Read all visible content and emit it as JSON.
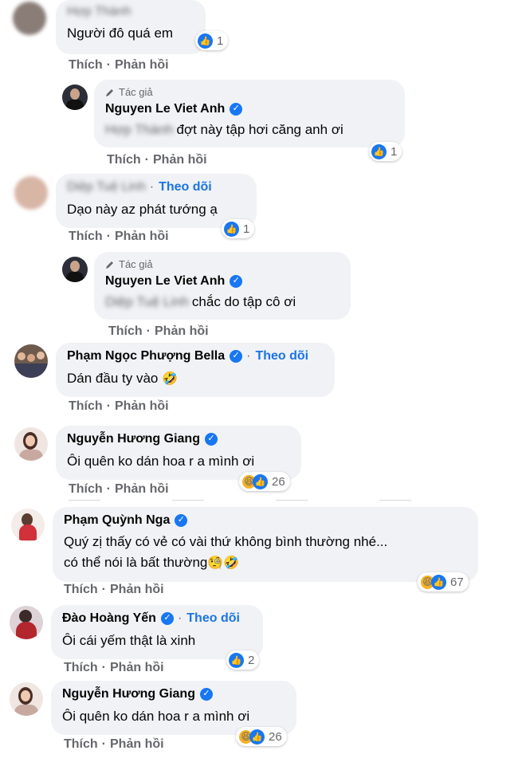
{
  "actions": {
    "like": "Thích",
    "reply": "Phản hồi"
  },
  "labels": {
    "author": "Tác giả",
    "follow": "Theo dõi",
    "dot": "·"
  },
  "comments": [
    {
      "name": "Hợp Thành",
      "text": "Người đô quá em",
      "reactions": "1"
    },
    {
      "name": "Nguyen Le Viet Anh",
      "mention": "Hợp Thành",
      "text": "đợt này tập hơi căng anh ơi",
      "reactions": "1"
    },
    {
      "name": "Diệp Tuệ Linh",
      "text": "Dạo này az phát tướng ạ",
      "reactions": "1"
    },
    {
      "name": "Nguyen Le Viet Anh",
      "mention": "Diệp Tuệ Linh",
      "text": "chắc do tập cô ơi"
    },
    {
      "name": "Phạm Ngọc Phượng Bella",
      "text": "Dán đầu ty vào",
      "emoji": "🤣"
    },
    {
      "name": "Nguyễn Hương Giang",
      "text": "Ôi quên ko dán hoa r a mình ơi",
      "reactions": "26"
    },
    {
      "name": "Phạm Quỳnh Nga",
      "text": "Quý zị thấy có vẻ có vài thứ không bình thường nhé...",
      "text2": "có thể nói là bất thường",
      "emoji": "🧐🤣",
      "reactions": "67"
    },
    {
      "name": "Đào Hoàng Yến",
      "text": "Ôi cái yếm thật là xinh",
      "reactions": "2"
    },
    {
      "name": "Nguyễn Hương Giang",
      "text": "Ôi quên ko dán hoa r a mình ơi",
      "reactions": "26"
    }
  ],
  "colors": {
    "bubble": "#f0f2f5",
    "accent": "#1877f2",
    "muted": "#65676b",
    "haha": "#f7b125"
  }
}
